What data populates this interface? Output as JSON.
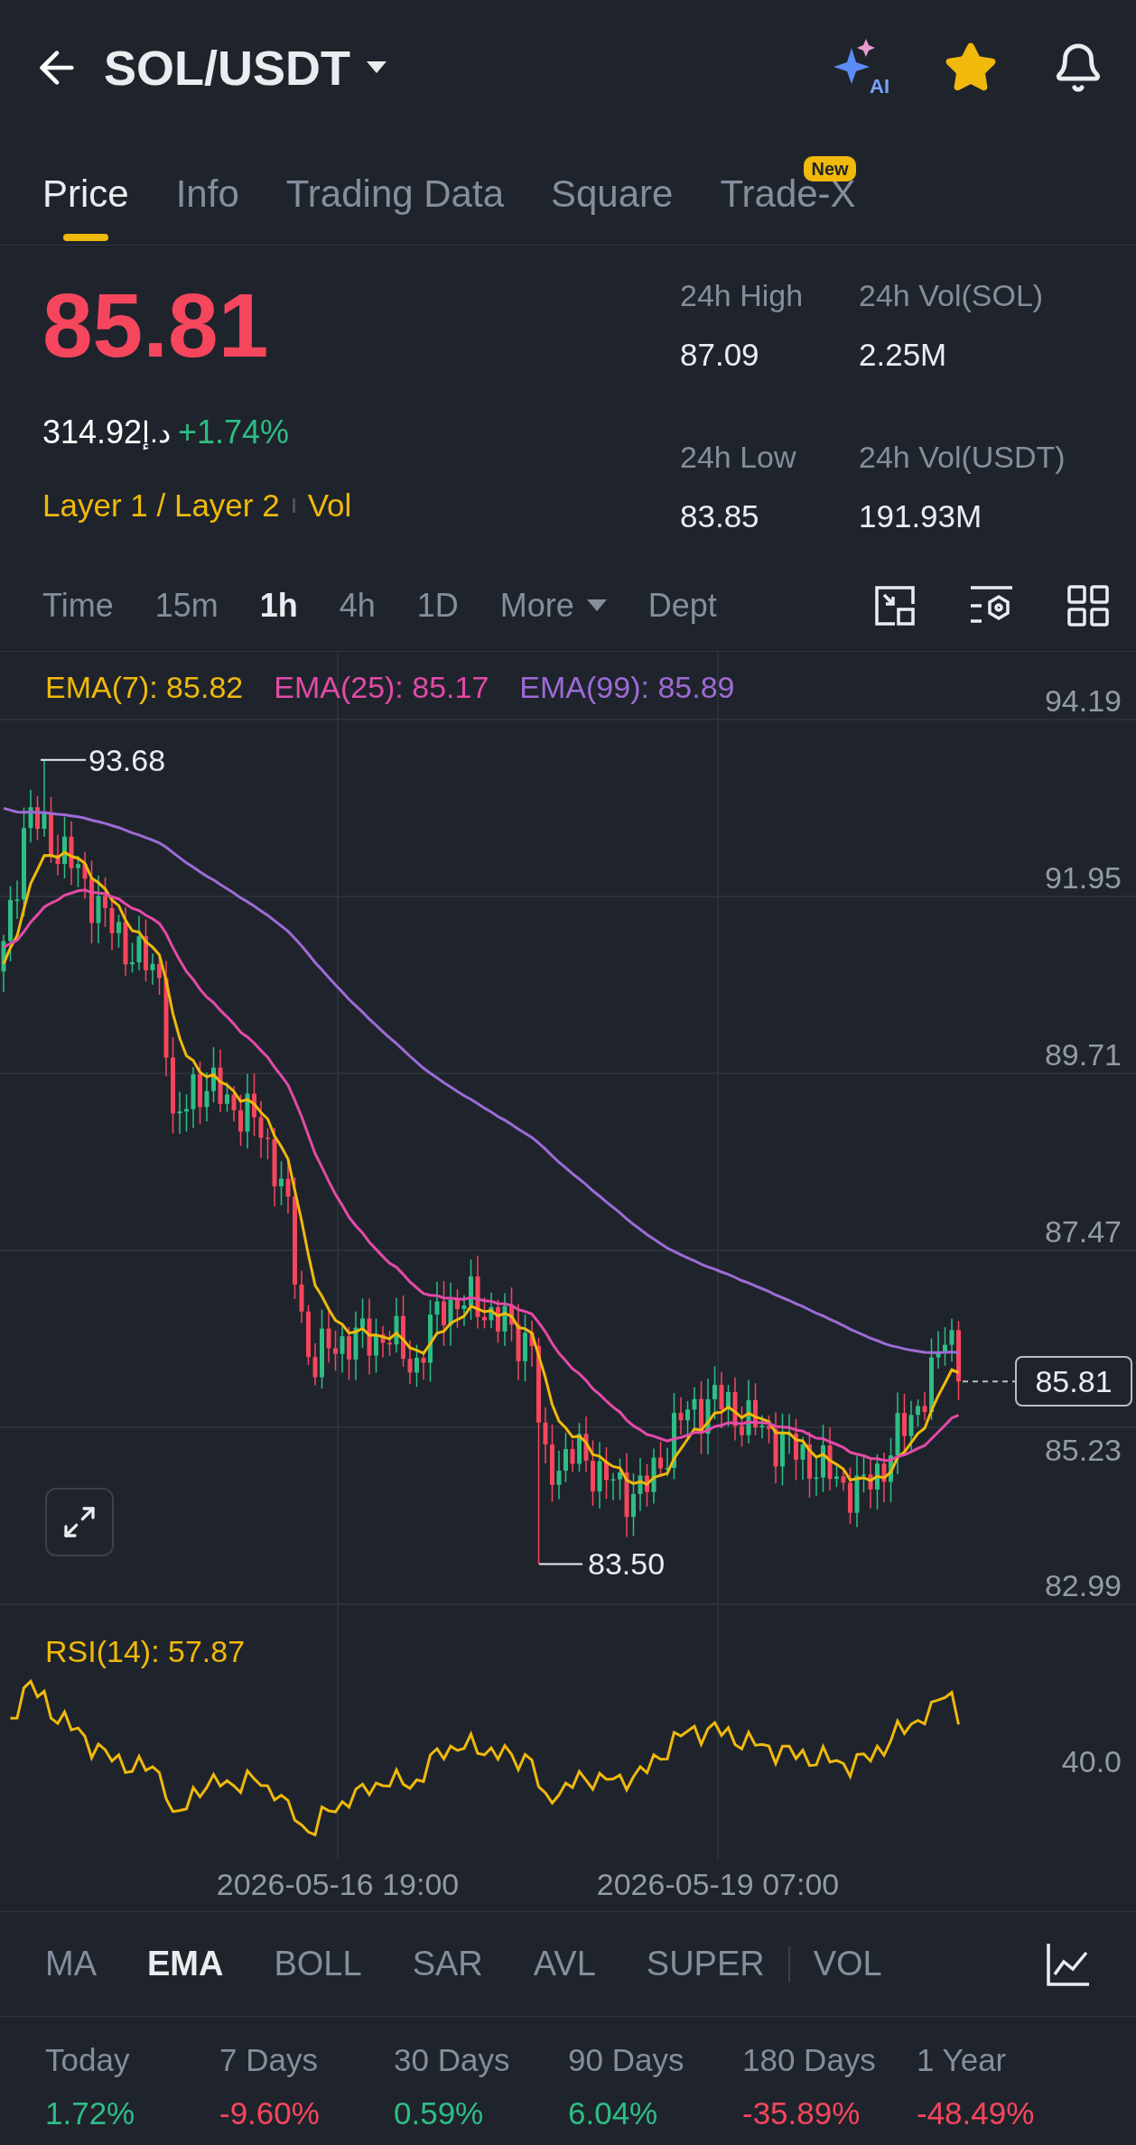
{
  "header": {
    "title": "SOL/USDT",
    "ai_label": "AI",
    "favorite": true
  },
  "tabs": [
    {
      "label": "Price",
      "selected": true
    },
    {
      "label": "Info",
      "selected": false
    },
    {
      "label": "Trading Data",
      "selected": false
    },
    {
      "label": "Square",
      "selected": false
    },
    {
      "label": "Trade-X",
      "selected": false,
      "badge": "New"
    }
  ],
  "ticker": {
    "last_price": "85.81",
    "price_falling": true,
    "fiat_value": "314.92",
    "fiat_symbol": "د.إ",
    "change": "+1.74%",
    "change_negative": false,
    "tags": [
      "Layer 1 / Layer 2",
      "Vol"
    ]
  },
  "stats": [
    {
      "label": "24h High",
      "value": "87.09"
    },
    {
      "label": "24h Vol(SOL)",
      "value": "2.25M"
    },
    {
      "label": "24h Low",
      "value": "83.85"
    },
    {
      "label": "24h Vol(USDT)",
      "value": "191.93M"
    }
  ],
  "intervals": [
    {
      "label": "Time",
      "selected": false
    },
    {
      "label": "15m",
      "selected": false
    },
    {
      "label": "1h",
      "selected": true
    },
    {
      "label": "4h",
      "selected": false
    },
    {
      "label": "1D",
      "selected": false
    },
    {
      "label": "More",
      "selected": false,
      "dropdown": true
    },
    {
      "label": "Dept",
      "selected": false
    }
  ],
  "chart": {
    "ema_legend": [
      {
        "label": "EMA(7): 85.82",
        "color": "#f0b90b"
      },
      {
        "label": "EMA(25): 85.17",
        "color": "#e44aa8"
      },
      {
        "label": "EMA(99): 85.89",
        "color": "#9d6bd6"
      }
    ],
    "price_axis": [
      "94.19",
      "91.95",
      "89.71",
      "87.47",
      "85.23",
      "82.99"
    ],
    "high_marker": "93.68",
    "low_marker": "83.50",
    "last_price_tag": "85.81",
    "rsi_label": "RSI(14): 57.87",
    "rsi_axis": "40.0",
    "time_axis": [
      "2026-05-16 19:00",
      "2026-05-19 07:00"
    ]
  },
  "indicators": [
    {
      "label": "MA",
      "selected": false,
      "kind": "main"
    },
    {
      "label": "EMA",
      "selected": true,
      "kind": "main"
    },
    {
      "label": "BOLL",
      "selected": false,
      "kind": "main"
    },
    {
      "label": "SAR",
      "selected": false,
      "kind": "main"
    },
    {
      "label": "AVL",
      "selected": false,
      "kind": "main"
    },
    {
      "label": "SUPER",
      "selected": false,
      "kind": "main"
    },
    {
      "label": "VOL",
      "selected": false,
      "kind": "sub"
    }
  ],
  "performance": [
    {
      "label": "Today",
      "value": "1.72%",
      "negative": false
    },
    {
      "label": "7 Days",
      "value": "-9.60%",
      "negative": true
    },
    {
      "label": "30 Days",
      "value": "0.59%",
      "negative": false
    },
    {
      "label": "90 Days",
      "value": "6.04%",
      "negative": false
    },
    {
      "label": "180 Days",
      "value": "-35.89%",
      "negative": true
    },
    {
      "label": "1 Year",
      "value": "-48.49%",
      "negative": true
    }
  ]
}
